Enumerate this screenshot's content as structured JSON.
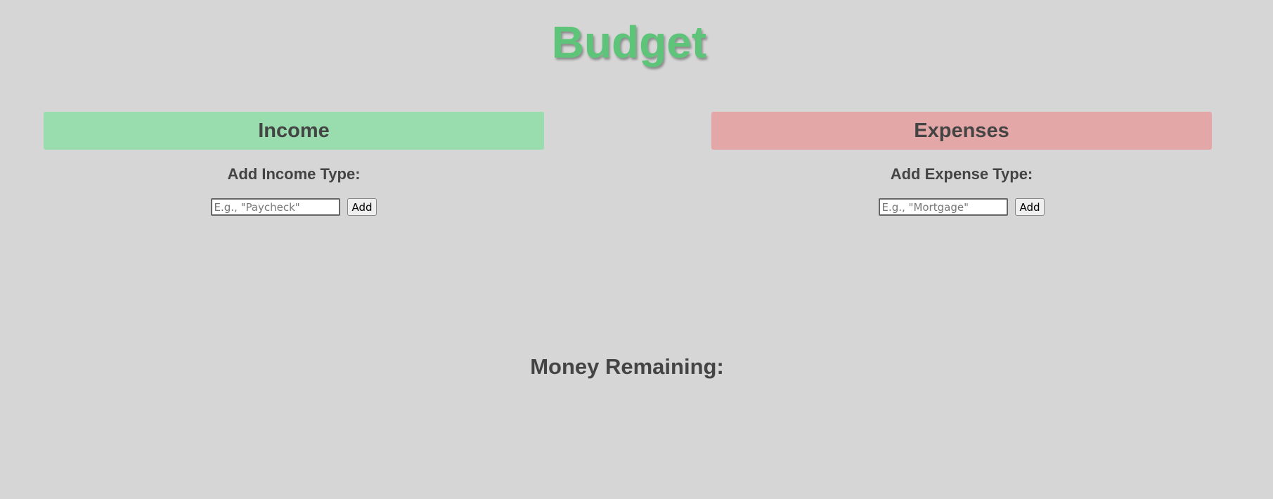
{
  "header": {
    "title": "Budget"
  },
  "income": {
    "heading": "Income",
    "add_label": "Add Income Type:",
    "input_placeholder": "E.g., \"Paycheck\"",
    "input_value": "",
    "add_button_label": "Add"
  },
  "expenses": {
    "heading": "Expenses",
    "add_label": "Add Expense Type:",
    "input_placeholder": "E.g., \"Mortgage\"",
    "input_value": "",
    "add_button_label": "Add"
  },
  "summary": {
    "money_remaining_label": "Money Remaining:"
  },
  "colors": {
    "background": "#d6d6d6",
    "title": "#5ec47a",
    "income_header": "#99dcae",
    "expenses_header": "#e4a7a7",
    "text": "#444444"
  }
}
